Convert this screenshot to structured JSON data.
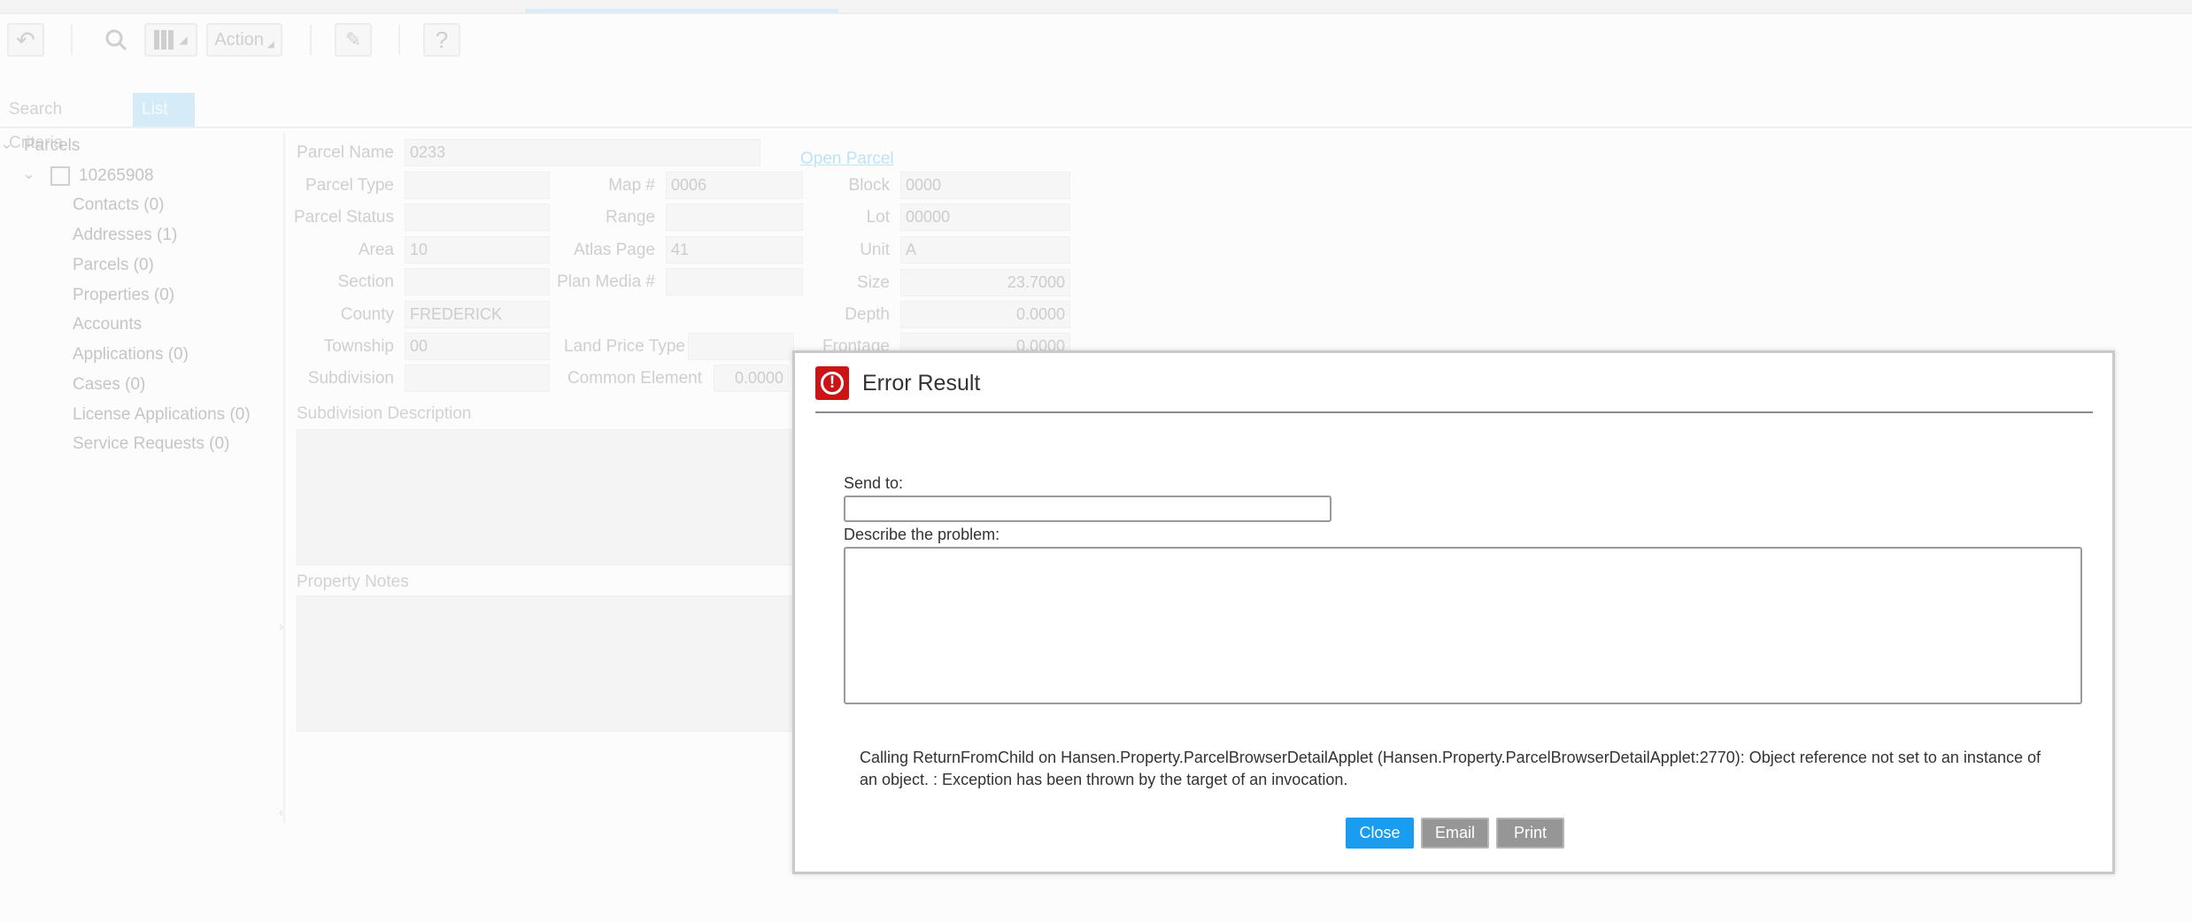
{
  "toolbar": {
    "back_icon": "back-arrow-icon",
    "search_icon": "search-icon",
    "map_icon": "map-icon",
    "action_label": "Action",
    "edit_icon": "eraser-icon",
    "help_label": "?"
  },
  "subtabs": {
    "search_criteria": "Search Criteria",
    "list": "List"
  },
  "tree": {
    "root": "Parcels",
    "parcel_id": "10265908",
    "children": [
      "Contacts (0)",
      "Addresses (1)",
      "Parcels (0)",
      "Properties (0)",
      "Accounts",
      "Applications (0)",
      "Cases (0)",
      "License Applications (0)",
      "Service Requests (0)"
    ]
  },
  "form": {
    "parcel_name_label": "Parcel Name",
    "parcel_name": "0233",
    "open_parcel": "Open Parcel",
    "parcel_type_label": "Parcel Type",
    "parcel_status_label": "Parcel Status",
    "area_label": "Area",
    "area": "10",
    "section_label": "Section",
    "county_label": "County",
    "county": "FREDERICK",
    "township_label": "Township",
    "township": "00",
    "subdivision_label": "Subdivision",
    "map_label": "Map #",
    "map": "0006",
    "range_label": "Range",
    "atlas_label": "Atlas Page",
    "atlas": "41",
    "plan_media_label": "Plan Media #",
    "land_price_label": "Land Price Type",
    "common_element_label": "Common Element",
    "common_element": "0.0000",
    "block_label": "Block",
    "block": "0000",
    "lot_label": "Lot",
    "lot": "00000",
    "unit_label": "Unit",
    "unit": "A",
    "size_label": "Size",
    "size": "23.7000",
    "depth_label": "Depth",
    "depth": "0.0000",
    "frontage_label": "Frontage",
    "frontage": "0.0000",
    "subdivision_desc_label": "Subdivision Description",
    "property_notes_label": "Property Notes"
  },
  "dialog": {
    "title": "Error Result",
    "send_to_label": "Send to:",
    "send_to_value": "",
    "describe_label": "Describe the problem:",
    "describe_value": "",
    "message": "Calling ReturnFromChild on Hansen.Property.ParcelBrowserDetailApplet (Hansen.Property.ParcelBrowserDetailApplet:2770): Object reference not set to an instance of an object. : Exception has been thrown by the target of an invocation.",
    "close_label": "Close",
    "email_label": "Email",
    "print_label": "Print",
    "accent_color": "#1a9df0",
    "error_color": "#cc1417"
  }
}
